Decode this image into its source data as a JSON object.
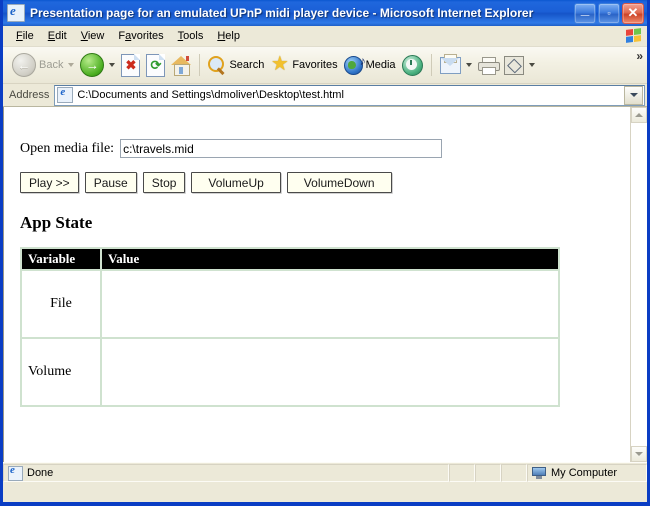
{
  "window": {
    "title": "Presentation page for an emulated UPnP midi player device - Microsoft Internet Explorer",
    "icon": "ie-document-icon",
    "controls": {
      "minimize": "_",
      "maximize": "▫",
      "close": "✕"
    }
  },
  "menu": {
    "items": [
      {
        "label": "File",
        "accel": "F"
      },
      {
        "label": "Edit",
        "accel": "E"
      },
      {
        "label": "View",
        "accel": "V"
      },
      {
        "label": "Favorites",
        "accel": "a"
      },
      {
        "label": "Tools",
        "accel": "T"
      },
      {
        "label": "Help",
        "accel": "H"
      }
    ],
    "brand_icon": "windows-flag-icon"
  },
  "toolbar": {
    "back_label": "Back",
    "search_label": "Search",
    "favorites_label": "Favorites",
    "media_label": "Media",
    "overflow_label": "»",
    "buttons": [
      {
        "name": "back-button",
        "label": "Back",
        "icon": "back-arrow-icon",
        "enabled": false
      },
      {
        "name": "forward-button",
        "label": "",
        "icon": "forward-arrow-icon",
        "enabled": true
      },
      {
        "name": "stop-button",
        "label": "",
        "icon": "stop-icon",
        "enabled": true
      },
      {
        "name": "refresh-button",
        "label": "",
        "icon": "refresh-icon",
        "enabled": true
      },
      {
        "name": "home-button",
        "label": "",
        "icon": "home-icon",
        "enabled": true
      },
      {
        "name": "search-button",
        "label": "Search",
        "icon": "search-icon",
        "enabled": true
      },
      {
        "name": "favorites-button",
        "label": "Favorites",
        "icon": "star-icon",
        "enabled": true
      },
      {
        "name": "media-button",
        "label": "Media",
        "icon": "media-globe-icon",
        "enabled": true
      },
      {
        "name": "history-button",
        "label": "",
        "icon": "history-icon",
        "enabled": true
      },
      {
        "name": "mail-button",
        "label": "",
        "icon": "mail-icon",
        "enabled": true
      },
      {
        "name": "print-button",
        "label": "",
        "icon": "printer-icon",
        "enabled": true
      },
      {
        "name": "edit-button",
        "label": "",
        "icon": "edit-page-icon",
        "enabled": true
      }
    ]
  },
  "address": {
    "label": "Address",
    "value": "C:\\Documents and Settings\\dmoliver\\Desktop\\test.html",
    "icon": "ie-document-icon",
    "dropdown_icon": "chevron-down-icon"
  },
  "page": {
    "form": {
      "file_label": "Open media file:",
      "file_value": "c:\\travels.mid",
      "file_placeholder": ""
    },
    "buttons": [
      {
        "label": "Play >>",
        "name": "play-button"
      },
      {
        "label": "Pause",
        "name": "pause-button"
      },
      {
        "label": "Stop",
        "name": "stop-button"
      },
      {
        "label": "VolumeUp",
        "name": "volume-up-button"
      },
      {
        "label": "VolumeDown",
        "name": "volume-down-button"
      }
    ],
    "state_heading": "App State",
    "table": {
      "columns": [
        "Variable",
        "Value"
      ],
      "rows": [
        {
          "variable": "File",
          "value": ""
        },
        {
          "variable": "Volume",
          "value": ""
        }
      ]
    }
  },
  "statusbar": {
    "status": "Done",
    "zone": "My Computer",
    "status_icon": "ie-document-icon",
    "zone_icon": "my-computer-icon"
  },
  "colors": {
    "titlebar_blue": "#1554c8",
    "window_border": "#0a3dc4",
    "chrome": "#ece9d8",
    "table_border_green": "#cfe2cf",
    "table_header_bg": "#000000",
    "button_face": "#fffff0"
  }
}
